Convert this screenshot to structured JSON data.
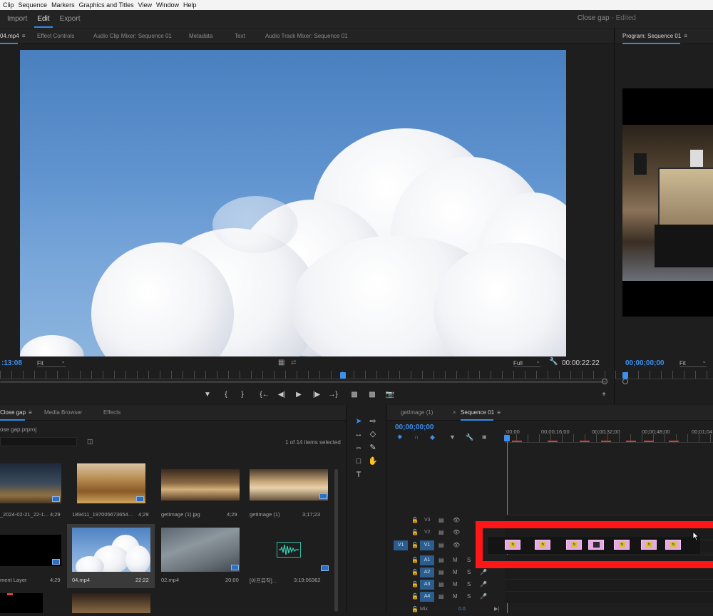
{
  "menubar": {
    "items": [
      "Clip",
      "Sequence",
      "Markers",
      "Graphics and Titles",
      "View",
      "Window",
      "Help"
    ]
  },
  "workspace": {
    "tabs": [
      "Import",
      "Edit",
      "Export"
    ],
    "active": "Edit"
  },
  "document": {
    "title": "Close gap",
    "separator": " - ",
    "status": "Edited"
  },
  "source_panel": {
    "tabs": [
      "04.mp4",
      "Effect Controls",
      "Audio Clip Mixer: Sequence 01",
      "Metadata",
      "Text",
      "Audio Track Mixer: Sequence 01"
    ],
    "timecode": ":13:08",
    "fit": "Fit",
    "quality": "Full",
    "duration": "00:00:22:22"
  },
  "program_panel": {
    "tab": "Program: Sequence 01",
    "timecode": "00;00;00;00",
    "fit": "Fit"
  },
  "project_panel": {
    "tabs": [
      "Close gap",
      "Media Browser",
      "Effects"
    ],
    "project_file": "ose gap.prproj",
    "selection_status": "1 of 14 items selected",
    "items": [
      {
        "name": "_2024-02-21_22-1...",
        "duration": "4;29"
      },
      {
        "name": "189411_197005673654...",
        "duration": "4;29"
      },
      {
        "name": "getImage (1).jpg",
        "duration": "4;29"
      },
      {
        "name": "getImage (1)",
        "duration": "3;17;23"
      },
      {
        "name": "ment Layer",
        "duration": "4;29"
      },
      {
        "name": "04.mp4",
        "duration": "22:22"
      },
      {
        "name": "02.mp4",
        "duration": "20:00"
      },
      {
        "name": "[아프뮤직]...",
        "duration": "3:19:06362"
      }
    ]
  },
  "timeline": {
    "tabs": [
      "getImage (1)",
      "Sequence 01"
    ],
    "timecode": "00;00;00;00",
    "ruler_marks": [
      ":00;00",
      "00;00;16;00",
      "00;00;32;00",
      "00;00;48;00",
      "00;01;04"
    ],
    "video_tracks": [
      "V3",
      "V2",
      "V1"
    ],
    "source_patch": "V1",
    "audio_tracks": [
      "A1",
      "A2",
      "A3",
      "A4"
    ],
    "mix_label": "Mix",
    "mix_value": "0.0",
    "m_label": "M",
    "s_label": "S",
    "fx_label": "fx",
    "clips_count": 7
  },
  "colors": {
    "accent_blue": "#2d8ceb",
    "clip_pink": "#e9a6e7",
    "highlight_red": "#ff1616"
  }
}
